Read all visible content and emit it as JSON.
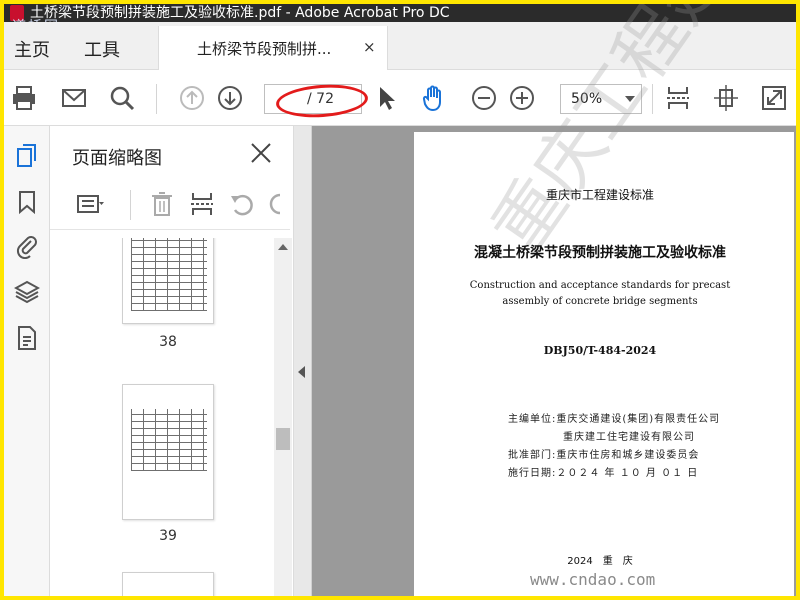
{
  "window": {
    "title": "土桥梁节段预制拼装施工及验收标准.pdf - Adobe Acrobat Pro DC",
    "watermark_logo": "道桥网"
  },
  "menu": {
    "home": "主页",
    "tools": "工具"
  },
  "tab": {
    "label": "土桥梁节段预制拼...",
    "close": "×"
  },
  "toolbar": {
    "page_current": "",
    "page_total": "/ 72",
    "zoom": "50%"
  },
  "panel": {
    "title": "页面缩略图",
    "thumbnails": [
      {
        "page": "38"
      },
      {
        "page": "39"
      }
    ]
  },
  "document": {
    "org_header": "重庆市工程建设标准",
    "title_cn": "混凝土桥梁节段预制拼装施工及验收标准",
    "title_en_line1": "Construction and acceptance standards for precast",
    "title_en_line2": "assembly of concrete bridge segments",
    "code": "DBJ50/T-484-2024",
    "lines": [
      "主编单位:重庆交通建设(集团)有限责任公司",
      "　　　　　重庆建工住宅建设有限公司",
      "批准部门:重庆市住房和城乡建设委员会",
      "施行日期:２０２４ 年 １０ 月 ０１ 日"
    ],
    "footer": "2024　重　庆",
    "watermark": "重庆工程建设",
    "site_watermark": "www.cndao.com"
  },
  "colors": {
    "accent_blue": "#1a73d8",
    "highlight_red": "#e31b1b",
    "frame_yellow": "#ffe600"
  }
}
